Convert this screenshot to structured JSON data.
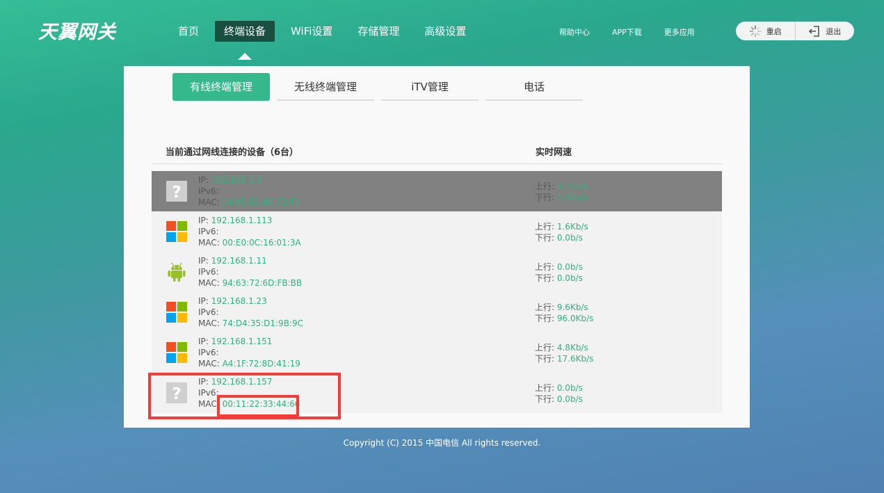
{
  "brand": {
    "logo_text": "天翼网关"
  },
  "nav": [
    {
      "label": "首页",
      "active": false
    },
    {
      "label": "终端设备",
      "active": true
    },
    {
      "label": "WiFi设置",
      "active": false
    },
    {
      "label": "存储管理",
      "active": false
    },
    {
      "label": "高级设置",
      "active": false
    }
  ],
  "top_links": [
    "帮助中心",
    "APP下载",
    "更多应用"
  ],
  "system": {
    "restart_label": "重启",
    "logout_label": "退出"
  },
  "subtabs": [
    {
      "label": "有线终端管理",
      "active": true
    },
    {
      "label": "无线终端管理",
      "active": false
    },
    {
      "label": "iTV管理",
      "active": false
    },
    {
      "label": "电话",
      "active": false
    }
  ],
  "list": {
    "title": "当前通过网线连接的设备（6台）",
    "rate_header": "实时网速",
    "labels": {
      "ip": "IP: ",
      "ipv6": "IPv6:",
      "mac": "MAC: ",
      "up": "上行: ",
      "down": "下行: "
    },
    "devices": [
      {
        "icon": "unknown-device-icon",
        "ip": "192.168.1.3",
        "ipv6": "",
        "mac": "04:95:E6:4C:32:F0",
        "up": "3.2Kb/s",
        "down": "1.6Kb/s"
      },
      {
        "icon": "windows-icon",
        "ip": "192.168.1.113",
        "ipv6": "",
        "mac": "00:E0:0C:16:01:3A",
        "up": "1.6Kb/s",
        "down": "0.0b/s"
      },
      {
        "icon": "android-icon",
        "ip": "192.168.1.11",
        "ipv6": "",
        "mac": "94:63:72:6D:FB:BB",
        "up": "0.0b/s",
        "down": "0.0b/s"
      },
      {
        "icon": "windows-icon",
        "ip": "192.168.1.23",
        "ipv6": "",
        "mac": "74:D4:35:D1:9B:9C",
        "up": "9.6Kb/s",
        "down": "96.0Kb/s"
      },
      {
        "icon": "windows-icon",
        "ip": "192.168.1.151",
        "ipv6": "",
        "mac": "A4:1F:72:8D:41:19",
        "up": "4.8Kb/s",
        "down": "17.6Kb/s"
      },
      {
        "icon": "unknown-device-icon",
        "ip": "192.168.1.157",
        "ipv6": "",
        "mac": "00:11:22:33:44:66",
        "up": "0.0b/s",
        "down": "0.0b/s"
      }
    ]
  },
  "footer": {
    "copyright": "Copyright (C) 2015 中国电信 All rights reserved."
  },
  "colors": {
    "accent": "#35b88c",
    "nav_active": "#184f3f",
    "value_green": "#2db37f",
    "highlight_row": "#818181",
    "annotation_red": "#f53a3a"
  }
}
